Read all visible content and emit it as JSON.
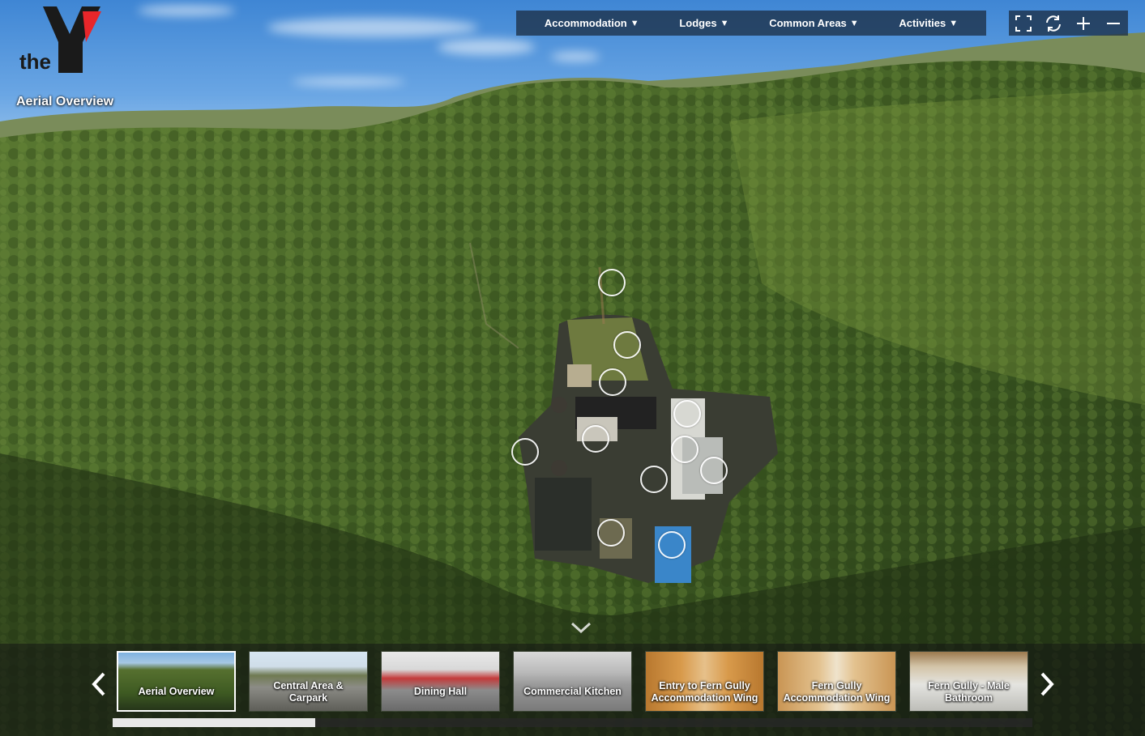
{
  "brand": {
    "logo_text": "the",
    "logo_colors": {
      "letter": "#1a1a1a",
      "accent": "#e8262a"
    }
  },
  "scene": {
    "title": "Aerial Overview"
  },
  "menu": {
    "items": [
      {
        "label": "Accommodation",
        "caret": "▼"
      },
      {
        "label": "Lodges",
        "caret": "▼"
      },
      {
        "label": "Common Areas",
        "caret": "▼"
      },
      {
        "label": "Activities",
        "caret": "▼"
      }
    ]
  },
  "controls": {
    "icons": [
      "fullscreen-icon",
      "autorotate-icon",
      "zoom-in-icon",
      "zoom-out-icon"
    ]
  },
  "hotspots": {
    "count": 11
  },
  "thumbnails": {
    "items": [
      {
        "label": "Aerial Overview",
        "active": true
      },
      {
        "label": "Central Area & Carpark",
        "active": false
      },
      {
        "label": "Dining Hall",
        "active": false
      },
      {
        "label": "Commercial Kitchen",
        "active": false
      },
      {
        "label": "Entry to Fern Gully Accommodation Wing",
        "active": false
      },
      {
        "label": "Fern Gully Accommodation Wing",
        "active": false
      },
      {
        "label": "Fern Gully - Male Bathroom",
        "active": false
      }
    ],
    "scroll_fraction": 0.22
  },
  "colors": {
    "panel_bg": "#1c3046",
    "accent_red": "#e8262a"
  }
}
